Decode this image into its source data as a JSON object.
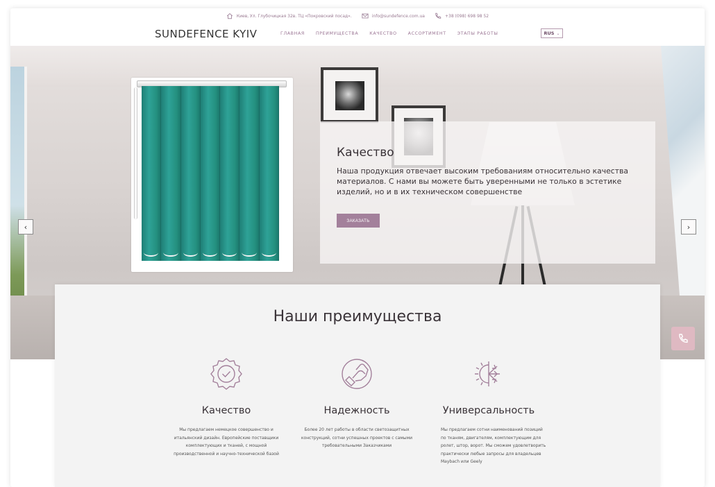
{
  "topbar": {
    "address": "Киев, Ул. Глубочицкая 32в. ТЦ «Покровский посад».",
    "email": "info@sundefence.com.ua",
    "phone": "+38 (098) 698 98 52"
  },
  "nav": {
    "logo": "SUNDEFENCE KYIV",
    "items": [
      "ГЛАВНАЯ",
      "ПРЕИМУЩЕСТВА",
      "КАЧЕСТВО",
      "АССОРТИМЕНТ",
      "ЭТАПЫ РАБОТЫ"
    ],
    "language": "RUS"
  },
  "slide": {
    "title": "Качество",
    "text": "Наша продукция отвечает высоким требованиям относительно качества материалов. С нами вы можете быть уверенными не только в эстетике изделий, но и в их техническом совершенстве",
    "button": "ЗАКАЗАТЬ"
  },
  "carousel": {
    "prev": "‹",
    "next": "›"
  },
  "advantages": {
    "heading": "Наши преимущества",
    "items": [
      {
        "icon": "quality-badge-icon",
        "title": "Качество",
        "text": "Мы предлагаем немецкое совершенство и итальянский дизайн. Европейские поставщики комплектующих и тканей, с мощной производственной и научно-технической базой"
      },
      {
        "icon": "handshake-icon",
        "title": "Надежность",
        "text": "Более 20 лет работы в области светозащитных конструкций, сотни успешных проектов с самыми требовательными Заказчиками"
      },
      {
        "icon": "sun-snowflake-icon",
        "title": "Универсальность",
        "text": "Мы предлагаем сотни наименований позиций по тканям, двигателям, комплектующим для ролет, штор, ворот. Мы сможем удовлетворить практически любые запросы для владельцев Maybach или Geely"
      }
    ]
  },
  "colors": {
    "accent": "#a3809b",
    "fab": "#dfb9c2",
    "blind": "#2a9a8e"
  }
}
